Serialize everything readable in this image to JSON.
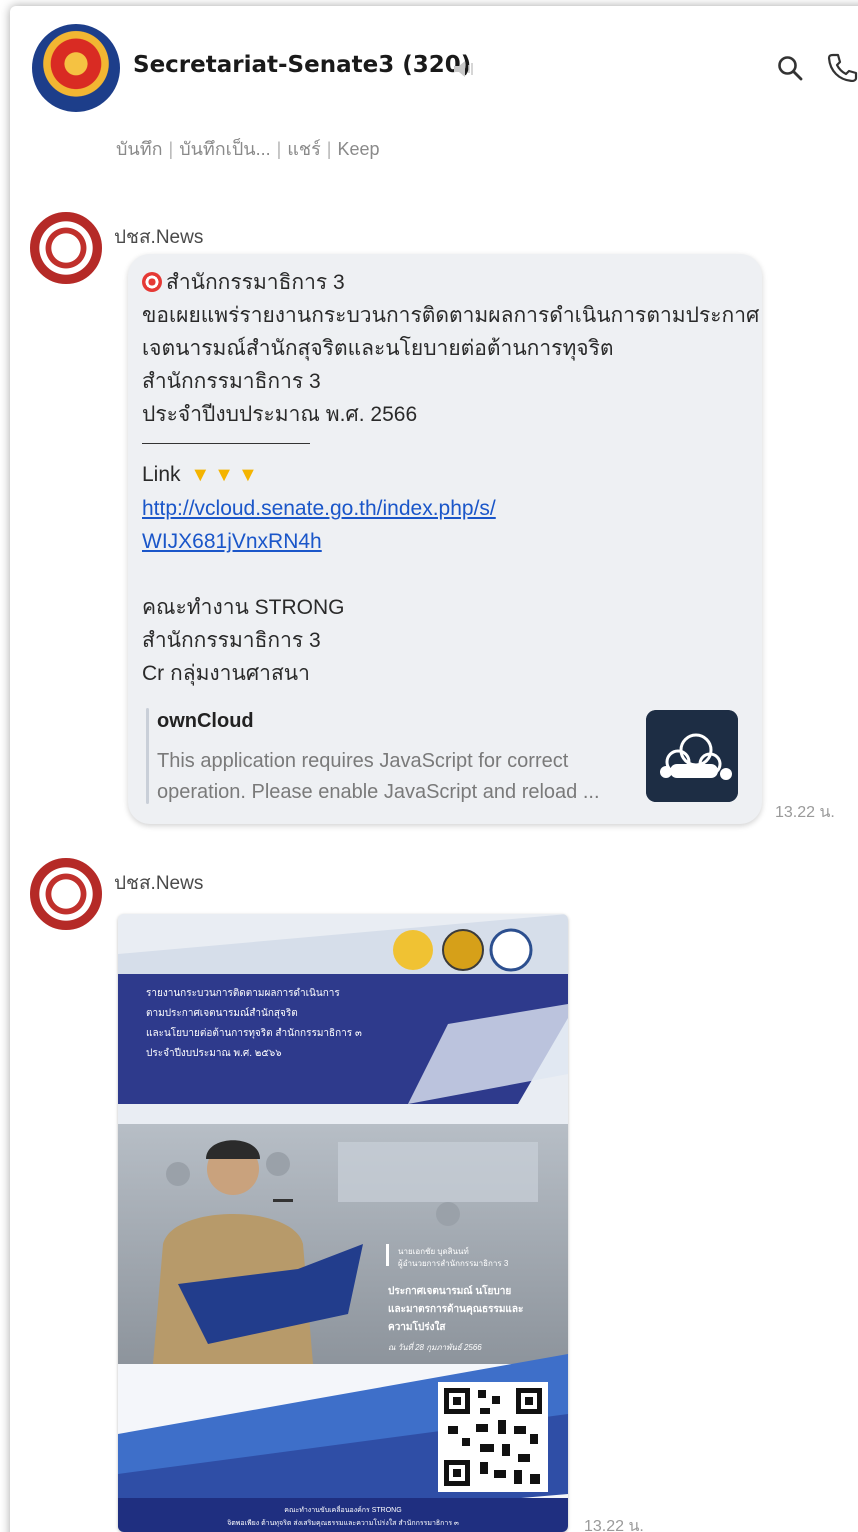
{
  "header": {
    "group_title": "Secretariat-Senate3 (320)",
    "notes_bar": [
      "บันทึก",
      "บันทึกเป็น...",
      "แชร์",
      "Keep"
    ]
  },
  "messages": [
    {
      "sender": "ปชส.News",
      "lines": [
        "สำนักกรรมาธิการ 3",
        "ขอเผยแพร่รายงานกระบวนการติดตามผลการดำเนินการตามประกาศ",
        "เจตนารมณ์สำนักสุจริตและนโยบายต่อต้านการทุจริต",
        "สำนักกรรมาธิการ 3",
        "ประจำปีงบประมาณ  พ.ศ. 2566"
      ],
      "link_prefix": "Link",
      "link_lines": [
        "http://vcloud.senate.go.th/index.php/s/",
        "WIJX681jVnxRN4h"
      ],
      "footer_lines": [
        "คณะทำงาน STRONG",
        "สำนักกรรมาธิการ 3",
        "Cr กลุ่มงานศาสนา"
      ],
      "preview": {
        "title": "ownCloud",
        "desc_lines": [
          "This application requires JavaScript for correct",
          "operation. Please enable JavaScript and reload ..."
        ]
      },
      "time": "13.22 น."
    },
    {
      "sender": "ปชส.News",
      "poster_text": {
        "title_lines": [
          "รายงานกระบวนการติดตามผลการดำเนินการ",
          "ตามประกาศเจตนารมณ์สำนักสุจริต",
          "และนโยบายต่อต้านการทุจริต สำนักกรรมาธิการ ๓",
          "ประจำปีงบประมาณ พ.ศ. ๒๕๖๖"
        ],
        "person_lines": [
          "นายเอกชัย  บุดสินนท์",
          "ผู้อำนวยการสำนักกรรมาธิการ 3"
        ],
        "policy_lines": [
          "ประกาศเจตนารมณ์ นโยบาย",
          "และมาตรการด้านคุณธรรมและ",
          "ความโปร่งใส"
        ],
        "date_line": "ณ วันที่ 28 กุมภาพันธ์ 2566",
        "footer_lines": [
          "คณะทำงานขับเคลื่อนองค์กร STRONG",
          "จิตพอเพียง ต้านทุจริต ส่งเสริมคุณธรรมและความโปร่งใส สำนักกรรมาธิการ ๓"
        ]
      },
      "time": "13.22 น."
    }
  ]
}
